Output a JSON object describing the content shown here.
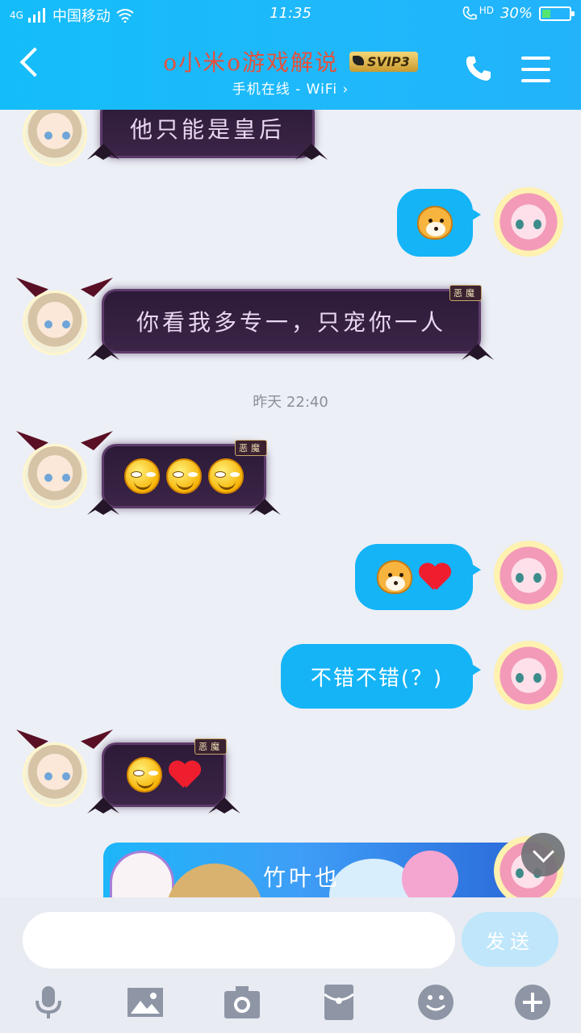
{
  "status_bar": {
    "network": "4G",
    "carrier": "中国移动",
    "time": "11:35",
    "hd": "HD",
    "battery": "30%",
    "battery_level": 0.3
  },
  "header": {
    "title": "o小米o游戏解说",
    "badge": "SVIP3",
    "subtitle": "手机在线 - WiFi",
    "subtitle_chevron": "›"
  },
  "messages": {
    "m1": {
      "text": "他只能是皇后"
    },
    "m3": {
      "text": "你看我多专一，只宠你一人",
      "tag": "恶魔"
    },
    "timestamp": "昨天 22:40",
    "m4": {
      "tag": "恶魔"
    },
    "m6": {
      "text": "不错不错(？)"
    },
    "m7": {
      "tag": "恶魔"
    },
    "banner_text": "竹叶也"
  },
  "input_bar": {
    "placeholder": "",
    "send_label": "发送"
  },
  "icons": [
    "back-icon",
    "phone-icon",
    "menu-icon",
    "mic-icon",
    "image-icon",
    "camera-icon",
    "red-packet-icon",
    "emoji-icon",
    "plus-icon",
    "chevron-down-icon"
  ],
  "colors": {
    "header": "#1fb8fb",
    "bubble_blue": "#14b4f7",
    "devil_bubble": "#2c1a38",
    "send_disabled": "#bfe6fa"
  }
}
